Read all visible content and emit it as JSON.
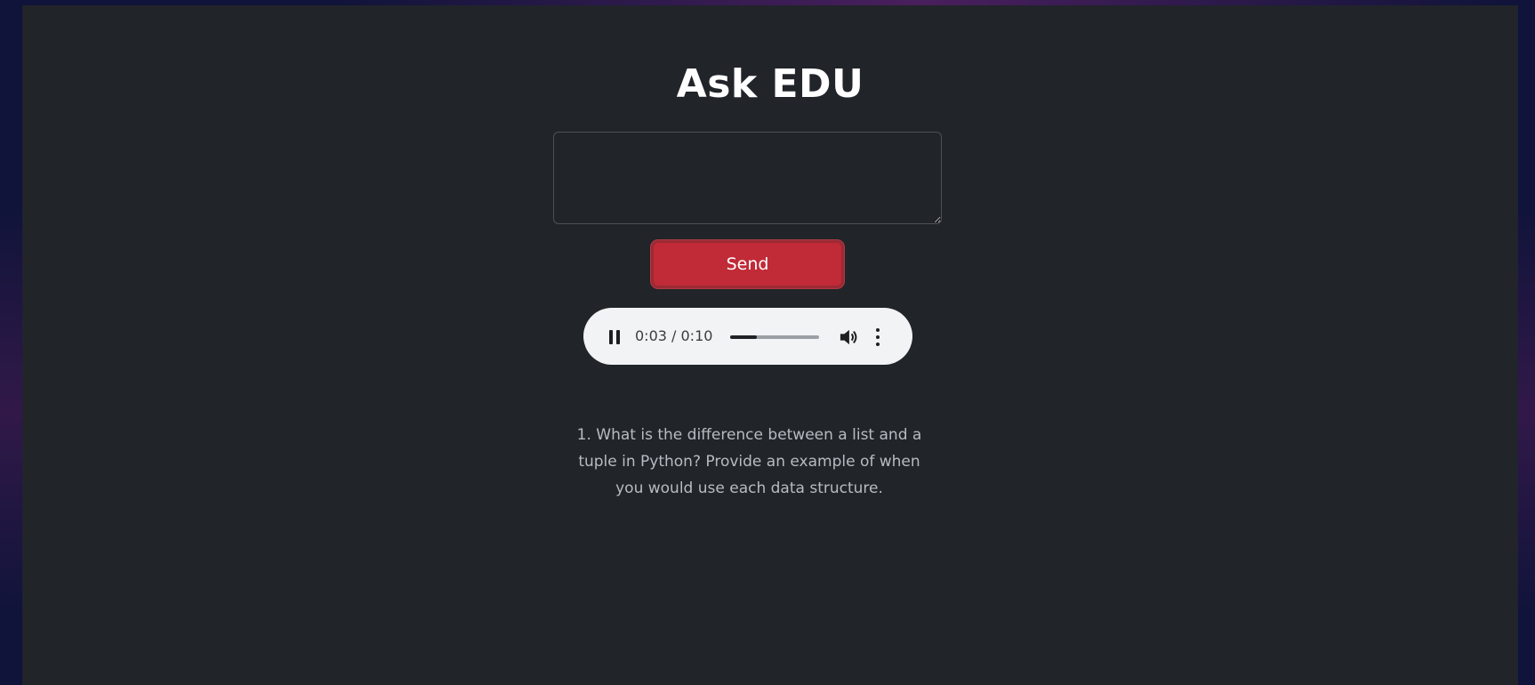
{
  "page": {
    "title": "Ask EDU"
  },
  "question_input": {
    "value": "",
    "placeholder": ""
  },
  "send_button": {
    "label": "Send",
    "color": "#c12a37"
  },
  "audio_player": {
    "state": "playing",
    "time_display": "0:03 / 0:10",
    "current_seconds": 3,
    "duration_seconds": 10,
    "progress_fraction": 0.3,
    "icons": {
      "play_state": "pause-icon",
      "volume": "volume-icon",
      "menu": "more-vert-icon"
    }
  },
  "response": {
    "text": "1. What is the difference between a list and a tuple in Python? Provide an example of when you would use each data structure."
  },
  "colors": {
    "background": "#10143a",
    "card": "#212429",
    "accent": "#c12a37",
    "text": "#ffffff",
    "muted_text": "#b7bcc2"
  }
}
